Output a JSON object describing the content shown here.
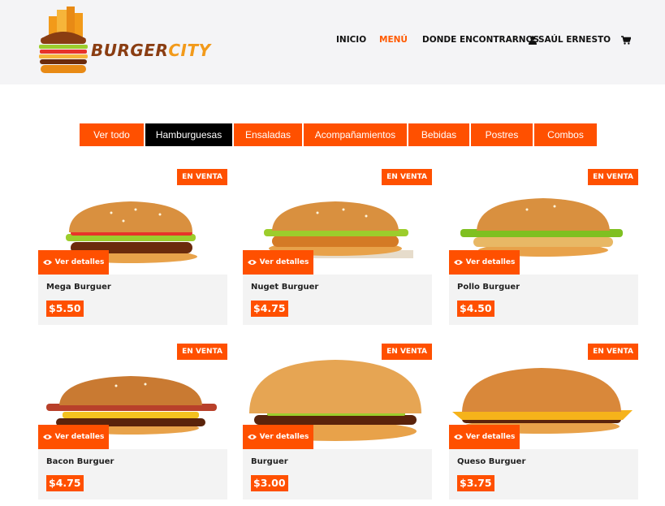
{
  "header": {
    "brand_part1": "BURGER",
    "brand_part2": "CITY",
    "nav": {
      "home": "INICIO",
      "menu": "MENÚ",
      "find_us": "DONDE ENCONTRARNOS",
      "user": "SAÚL ERNESTO"
    },
    "icons": {
      "user": "user-icon",
      "cart": "cart-icon"
    }
  },
  "tabs": [
    {
      "label": "Ver todo",
      "active": false
    },
    {
      "label": "Hamburguesas",
      "active": true
    },
    {
      "label": "Ensaladas",
      "active": false
    },
    {
      "label": "Acompañamientos",
      "active": false
    },
    {
      "label": "Bebidas",
      "active": false
    },
    {
      "label": "Postres",
      "active": false
    },
    {
      "label": "Combos",
      "active": false
    }
  ],
  "products": [
    {
      "badge": "EN VENTA",
      "details": "Ver detalles",
      "name": "Mega Burguer",
      "price": "$5.50"
    },
    {
      "badge": "EN VENTA",
      "details": "Ver detalles",
      "name": "Nuget Burguer",
      "price": "$4.75"
    },
    {
      "badge": "EN VENTA",
      "details": "Ver detalles",
      "name": "Pollo Burguer",
      "price": "$4.50"
    },
    {
      "badge": "EN VENTA",
      "details": "Ver detalles",
      "name": "Bacon Burguer",
      "price": "$4.75"
    },
    {
      "badge": "EN VENTA",
      "details": "Ver detalles",
      "name": "Burguer",
      "price": "$3.00"
    },
    {
      "badge": "EN VENTA",
      "details": "Ver detalles",
      "name": "Queso Burguer",
      "price": "$3.75"
    }
  ],
  "colors": {
    "accent": "#ff5000",
    "active_tab": "#000000",
    "header_bg": "#f4f4f6",
    "card_bg": "#f3f3f3"
  }
}
